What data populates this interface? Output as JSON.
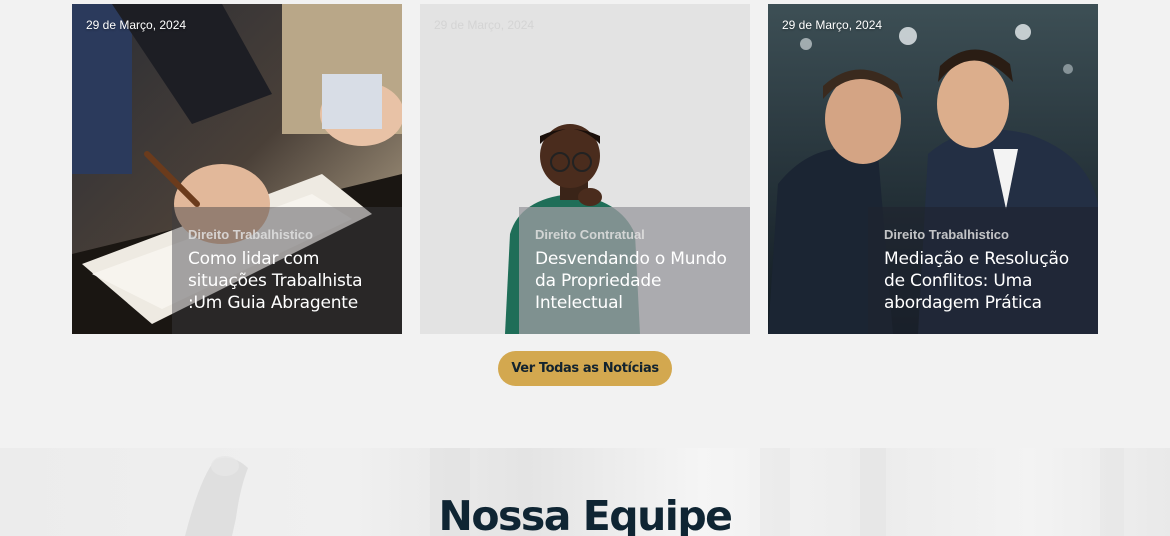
{
  "news": [
    {
      "date": "29 de Março, 2024",
      "category": "Direito Trabalhistico",
      "title": "Como lidar com situações Trabalhista :Um Guia Abragente"
    },
    {
      "date": "29 de Março, 2024",
      "category": "Direito Contratual",
      "title": "Desvendando o Mundo da Propriedade Intelectual"
    },
    {
      "date": "29 de Março, 2024",
      "category": "Direito Trabalhistico",
      "title": "Mediação e Resolução de Conflitos: Uma abordagem Prática"
    }
  ],
  "cta": {
    "label": "Ver Todas as Notícias"
  },
  "team": {
    "title": "Nossa Equipe"
  },
  "colors": {
    "accent": "#d3a84f",
    "heading": "#0f2533",
    "background": "#f2f2f2"
  }
}
